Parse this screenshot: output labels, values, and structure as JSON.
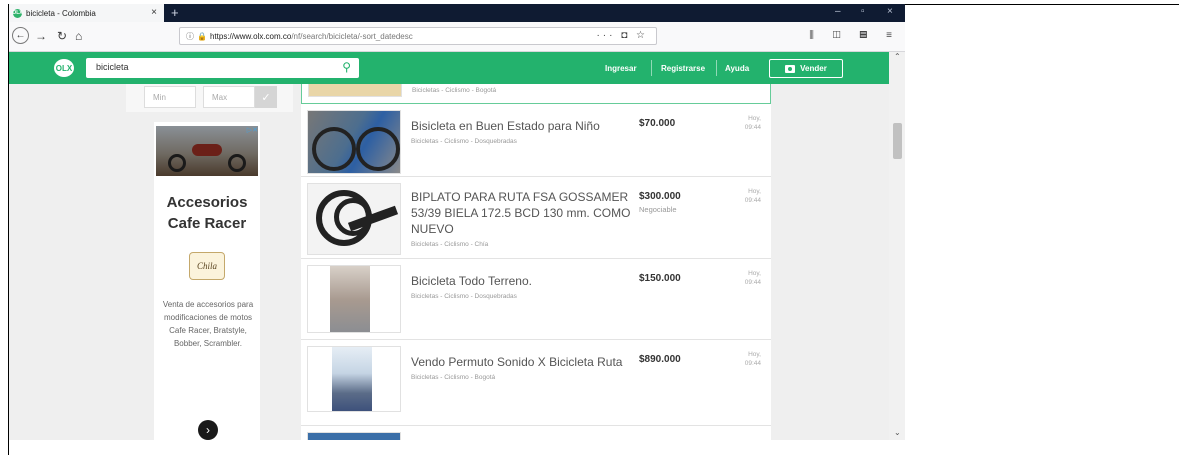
{
  "browser": {
    "tab_title": "bicicleta - Colombia",
    "tab_favicon": "OLX",
    "url_host": "https://www.olx.com.co",
    "url_path": "/nf/search/bicicleta/-sort_datedesc"
  },
  "olx": {
    "logo": "OLX",
    "search_value": "bicicleta",
    "links": [
      "Ingresar",
      "Registrarse",
      "Ayuda"
    ],
    "sell_button": "Vender"
  },
  "filters": {
    "min_placeholder": "Min",
    "max_placeholder": "Max"
  },
  "ad": {
    "title_line1": "Accesorios",
    "title_line2": "Cafe Racer",
    "logo_text": "Chila",
    "body": "Venta de accesorios para modificaciones de motos Cafe Racer, Bratstyle, Bobber, Scrambler."
  },
  "listings": [
    {
      "title": "",
      "price": "",
      "negotiable": "",
      "category": "Bicicletas - Ciclismo - Bogotá",
      "date_day": "",
      "date_time": ""
    },
    {
      "title": "Bisicleta en Buen Estado para Niño",
      "price": "$70.000",
      "negotiable": "",
      "category": "Bicicletas - Ciclismo - Dosquebradas",
      "date_day": "Hoy,",
      "date_time": "09:44"
    },
    {
      "title": "BIPLATO PARA RUTA FSA GOSSAMER 53/39 BIELA 172.5 BCD 130 mm. COMO NUEVO",
      "price": "$300.000",
      "negotiable": "Negociable",
      "category": "Bicicletas - Ciclismo - Chía",
      "date_day": "Hoy,",
      "date_time": "09:44"
    },
    {
      "title": "Bicicleta Todo Terreno.",
      "price": "$150.000",
      "negotiable": "",
      "category": "Bicicletas - Ciclismo - Dosquebradas",
      "date_day": "Hoy,",
      "date_time": "09:44"
    },
    {
      "title": "Vendo Permuto Sonido X Bicicleta Ruta",
      "price": "$890.000",
      "negotiable": "",
      "category": "Bicicletas - Ciclismo - Bogotá",
      "date_day": "Hoy,",
      "date_time": "09:44"
    }
  ],
  "colors": {
    "olx_green": "#23b26d",
    "tab_bar": "#0f1b32"
  }
}
